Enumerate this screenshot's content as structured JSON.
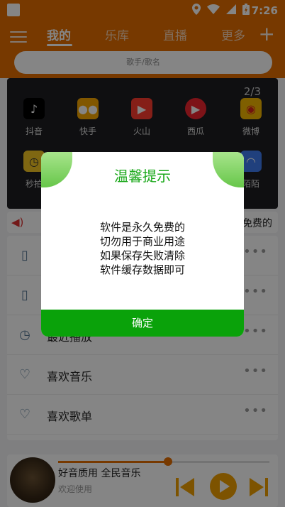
{
  "status_bar": {
    "time": "7:26",
    "icons": [
      "location-icon",
      "wifi-icon",
      "signal-icon",
      "battery-icon"
    ]
  },
  "header": {
    "tabs": [
      {
        "label": "我的",
        "active": true
      },
      {
        "label": "乐库",
        "active": false
      },
      {
        "label": "直播",
        "active": false
      },
      {
        "label": "更多",
        "active": false
      }
    ],
    "search_placeholder": "歌手/歌名"
  },
  "apps_panel": {
    "pager": "2/3",
    "apps": [
      {
        "label": "抖音",
        "icon": "douyin-icon",
        "color": "#000000"
      },
      {
        "label": "快手",
        "icon": "kuaishou-icon",
        "color": "#f7a800"
      },
      {
        "label": "火山",
        "icon": "huoshan-icon",
        "color": "#ff3d2e"
      },
      {
        "label": "西瓜",
        "icon": "xigua-icon",
        "color": "#f0262f"
      },
      {
        "label": "微博",
        "icon": "weibo-icon",
        "color": "#f4b600"
      },
      {
        "label": "秒拍",
        "icon": "miaopai-icon",
        "color": "#f3c623"
      },
      {
        "label": "陌陌",
        "icon": "momo-icon",
        "color": "#3f7bf0"
      }
    ]
  },
  "notice": {
    "text": "免费的"
  },
  "list": {
    "items": [
      {
        "label": "",
        "icon": "music-file-icon"
      },
      {
        "label": "",
        "icon": "download-icon"
      },
      {
        "label": "最近播放",
        "icon": "clock-icon"
      },
      {
        "label": "喜欢音乐",
        "icon": "heart-icon"
      },
      {
        "label": "喜欢歌单",
        "icon": "heart-icon"
      }
    ]
  },
  "player": {
    "title": "好音质用 全民音乐",
    "subtitle": "欢迎使用",
    "progress": 0.52,
    "accent": "#e46d00"
  },
  "dialog": {
    "title": "温馨提示",
    "message_lines": [
      "软件是永久免费的",
      "切勿用于商业用途",
      "如果保存失败清除",
      "软件缓存数据即可"
    ],
    "confirm_label": "确定",
    "title_color": "#1aa81a",
    "button_color": "#0aa20a"
  }
}
